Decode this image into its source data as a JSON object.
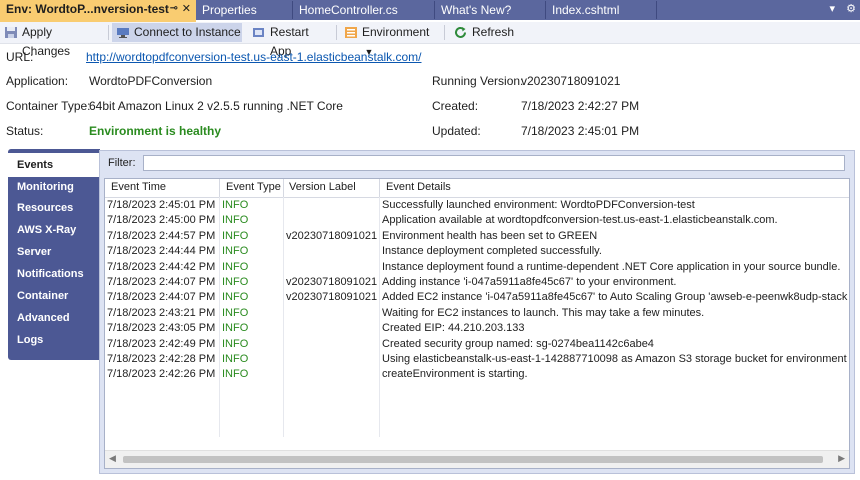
{
  "tabs": [
    {
      "label": "Env: WordtoP...nversion-test",
      "active": true
    },
    {
      "label": "Properties"
    },
    {
      "label": "HomeController.cs"
    },
    {
      "label": "What's New?"
    },
    {
      "label": "Index.cshtml"
    }
  ],
  "toolbar": {
    "apply_changes": "Apply Changes",
    "connect_to_instance": "Connect to Instance",
    "restart_app": "Restart App",
    "environment": "Environment",
    "refresh": "Refresh"
  },
  "info": {
    "url_label": "URL:",
    "url_value": "http://wordtopdfconversion-test.us-east-1.elasticbeanstalk.com/",
    "application_label": "Application:",
    "application_value": "WordtoPDFConversion",
    "container_type_label": "Container Type:",
    "container_type_value": "64bit Amazon Linux 2 v2.5.5 running .NET Core",
    "status_label": "Status:",
    "status_value": "Environment is healthy",
    "running_version_label": "Running Version:",
    "running_version_value": "v20230718091021",
    "created_label": "Created:",
    "created_value": "7/18/2023 2:42:27 PM",
    "updated_label": "Updated:",
    "updated_value": "7/18/2023 2:45:01 PM"
  },
  "sidenav": [
    "Events",
    "Monitoring",
    "Resources",
    "AWS X-Ray",
    "Server",
    "Notifications",
    "Container",
    "Advanced",
    "Logs"
  ],
  "events": {
    "filter_label": "Filter:",
    "filter_value": "",
    "columns": [
      "Event Time",
      "Event Type",
      "Version Label",
      "Event Details"
    ],
    "rows": [
      [
        "7/18/2023 2:45:01 PM",
        "INFO",
        "",
        "Successfully launched environment: WordtoPDFConversion-test"
      ],
      [
        "7/18/2023 2:45:00 PM",
        "INFO",
        "",
        "Application available at wordtopdfconversion-test.us-east-1.elasticbeanstalk.com."
      ],
      [
        "7/18/2023 2:44:57 PM",
        "INFO",
        "v20230718091021",
        "Environment health has been set to GREEN"
      ],
      [
        "7/18/2023 2:44:44 PM",
        "INFO",
        "",
        "Instance deployment completed successfully."
      ],
      [
        "7/18/2023 2:44:42 PM",
        "INFO",
        "",
        "Instance deployment found a runtime-dependent .NET Core application in your source bundle."
      ],
      [
        "7/18/2023 2:44:07 PM",
        "INFO",
        "v20230718091021",
        "Adding instance 'i-047a5911a8fe45c67' to your environment."
      ],
      [
        "7/18/2023 2:44:07 PM",
        "INFO",
        "v20230718091021",
        "Added EC2 instance 'i-047a5911a8fe45c67' to Auto Scaling Group 'awseb-e-peenwk8udp-stack"
      ],
      [
        "7/18/2023 2:43:21 PM",
        "INFO",
        "",
        "Waiting for EC2 instances to launch. This may take a few minutes."
      ],
      [
        "7/18/2023 2:43:05 PM",
        "INFO",
        "",
        "Created EIP: 44.210.203.133"
      ],
      [
        "7/18/2023 2:42:49 PM",
        "INFO",
        "",
        "Created security group named: sg-0274bea1142c6abe4"
      ],
      [
        "7/18/2023 2:42:28 PM",
        "INFO",
        "",
        "Using elasticbeanstalk-us-east-1-142887710098 as Amazon S3 storage bucket for environment"
      ],
      [
        "7/18/2023 2:42:26 PM",
        "INFO",
        "",
        "createEnvironment is starting."
      ]
    ]
  },
  "colors": {
    "tabbar": "#5b679e",
    "active_tab": "#f9cc71",
    "sidenav": "#4c5894",
    "healthy": "#2a8b1f",
    "link": "#0b57b0"
  }
}
